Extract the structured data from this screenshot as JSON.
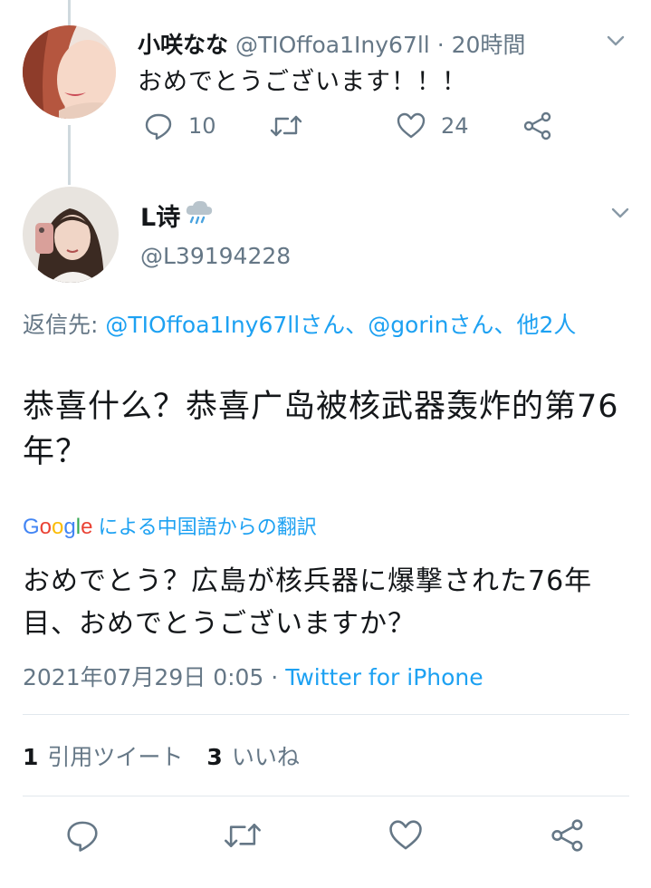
{
  "reply_tweet": {
    "display_name": "小咲なな",
    "handle": "@TIOffoa1Iny67ll",
    "separator": "·",
    "time_ago": "20時間",
    "text": "おめでとうございます！！！",
    "reply_count": "10",
    "like_count": "24",
    "icons": [
      "reply-icon",
      "retweet-icon",
      "like-icon",
      "share-icon",
      "chevron-down-icon"
    ]
  },
  "main_tweet": {
    "display_name": "L诗",
    "name_emoji": "rain-cloud-emoji",
    "handle": "@L39194228",
    "reply_to_prefix": "返信先: ",
    "reply_to_user1": "@TIOffoa1Iny67llさん",
    "reply_to_sep1": "、",
    "reply_to_user2": "@gorinさん",
    "reply_to_sep2": "、",
    "reply_to_others": "他2人",
    "text": "恭喜什么？恭喜广岛被核武器轰炸的第76年？",
    "translate_brand": "Google",
    "translate_label": "による中国語からの翻訳",
    "translated_text": "おめでとう？広島が核兵器に爆撃された76年目、おめでとうございますか？",
    "timestamp": "2021年07月29日 0:05",
    "timestamp_sep": " · ",
    "source": "Twitter for iPhone",
    "quote_count": "1",
    "quote_label": "引用ツイート",
    "like_count": "3",
    "like_label": "いいね"
  },
  "colors": {
    "accent": "#1da1f2",
    "secondary_text": "#657786",
    "primary_text": "#14171a",
    "divider": "#e1e8ed",
    "thread_line": "#cfd9de"
  }
}
